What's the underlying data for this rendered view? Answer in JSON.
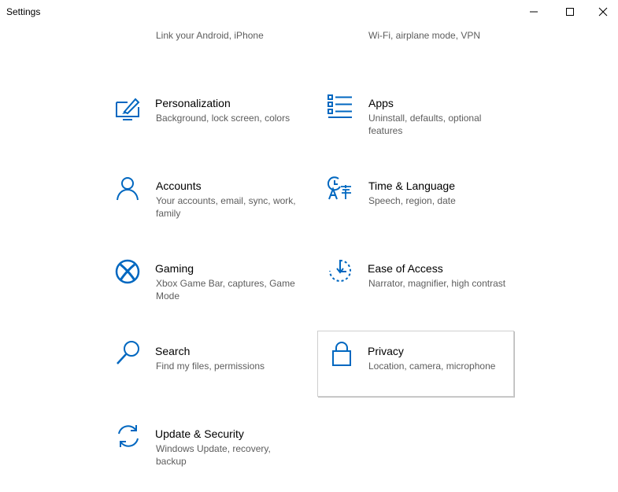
{
  "window": {
    "title": "Settings",
    "controls": {
      "minimize": "minimize-icon",
      "maximize": "maximize-icon",
      "close": "close-icon"
    }
  },
  "accent_color": "#0067c0",
  "tiles": [
    {
      "id": "phone",
      "icon": "phone-icon",
      "label": "",
      "desc": "Link your Android, iPhone"
    },
    {
      "id": "network",
      "icon": "globe-icon",
      "label": "",
      "desc": "Wi-Fi, airplane mode, VPN"
    },
    {
      "id": "personalization",
      "icon": "paintbrush-screen-icon",
      "label": "Personalization",
      "desc": "Background, lock screen, colors"
    },
    {
      "id": "apps",
      "icon": "apps-list-icon",
      "label": "Apps",
      "desc": "Uninstall, defaults, optional features"
    },
    {
      "id": "accounts",
      "icon": "person-icon",
      "label": "Accounts",
      "desc": "Your accounts, email, sync, work, family"
    },
    {
      "id": "time-language",
      "icon": "time-language-icon",
      "label": "Time & Language",
      "desc": "Speech, region, date"
    },
    {
      "id": "gaming",
      "icon": "xbox-icon",
      "label": "Gaming",
      "desc": "Xbox Game Bar, captures, Game Mode"
    },
    {
      "id": "ease-of-access",
      "icon": "ease-of-access-icon",
      "label": "Ease of Access",
      "desc": "Narrator, magnifier, high contrast"
    },
    {
      "id": "search",
      "icon": "magnifier-icon",
      "label": "Search",
      "desc": "Find my files, permissions"
    },
    {
      "id": "privacy",
      "icon": "lock-icon",
      "label": "Privacy",
      "desc": "Location, camera, microphone"
    },
    {
      "id": "update-security",
      "icon": "sync-arrows-icon",
      "label": "Update & Security",
      "desc": "Windows Update, recovery, backup"
    }
  ]
}
